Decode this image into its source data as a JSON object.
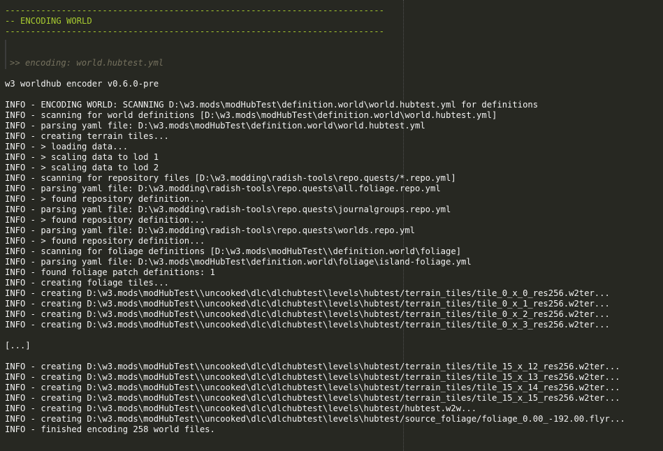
{
  "header": {
    "separator_top": "--------------------------------------------------------------------------",
    "title": "-- ENCODING WORLD",
    "separator_bottom": "--------------------------------------------------------------------------",
    "hint": ">> encoding: world.hubtest.yml"
  },
  "version_line": "w3 worldhub encoder v0.6.0-pre",
  "log_block_1": [
    "INFO - ENCODING WORLD: SCANNING D:\\w3.mods\\modHubTest\\definition.world\\world.hubtest.yml for definitions",
    "INFO - scanning for world definitions [D:\\w3.mods\\modHubTest\\definition.world\\world.hubtest.yml]",
    "INFO - parsing yaml file: D:\\w3.mods\\modHubTest\\definition.world\\world.hubtest.yml",
    "INFO - creating terrain tiles...",
    "INFO - > loading data...",
    "INFO - > scaling data to lod 1",
    "INFO - > scaling data to lod 2",
    "INFO - scanning for repository files [D:\\w3.modding\\radish-tools\\repo.quests/*.repo.yml]",
    "INFO - parsing yaml file: D:\\w3.modding\\radish-tools\\repo.quests\\all.foliage.repo.yml",
    "INFO - > found repository definition...",
    "INFO - parsing yaml file: D:\\w3.modding\\radish-tools\\repo.quests\\journalgroups.repo.yml",
    "INFO - > found repository definition...",
    "INFO - parsing yaml file: D:\\w3.modding\\radish-tools\\repo.quests\\worlds.repo.yml",
    "INFO - > found repository definition...",
    "INFO - scanning for foliage definitions [D:\\w3.mods\\modHubTest\\\\definition.world\\foliage]",
    "INFO - parsing yaml file: D:\\w3.mods\\modHubTest\\definition.world\\foliage\\island-foliage.yml",
    "INFO - found foliage patch definitions: 1",
    "INFO - creating foliage tiles...",
    "INFO - creating D:\\w3.mods\\modHubTest\\\\uncooked\\dlc\\dlchubtest\\levels\\hubtest/terrain_tiles/tile_0_x_0_res256.w2ter...",
    "INFO - creating D:\\w3.mods\\modHubTest\\\\uncooked\\dlc\\dlchubtest\\levels\\hubtest/terrain_tiles/tile_0_x_1_res256.w2ter...",
    "INFO - creating D:\\w3.mods\\modHubTest\\\\uncooked\\dlc\\dlchubtest\\levels\\hubtest/terrain_tiles/tile_0_x_2_res256.w2ter...",
    "INFO - creating D:\\w3.mods\\modHubTest\\\\uncooked\\dlc\\dlchubtest\\levels\\hubtest/terrain_tiles/tile_0_x_3_res256.w2ter..."
  ],
  "ellipsis": "[...]",
  "log_block_2": [
    "INFO - creating D:\\w3.mods\\modHubTest\\\\uncooked\\dlc\\dlchubtest\\levels\\hubtest/terrain_tiles/tile_15_x_12_res256.w2ter...",
    "INFO - creating D:\\w3.mods\\modHubTest\\\\uncooked\\dlc\\dlchubtest\\levels\\hubtest/terrain_tiles/tile_15_x_13_res256.w2ter...",
    "INFO - creating D:\\w3.mods\\modHubTest\\\\uncooked\\dlc\\dlchubtest\\levels\\hubtest/terrain_tiles/tile_15_x_14_res256.w2ter...",
    "INFO - creating D:\\w3.mods\\modHubTest\\\\uncooked\\dlc\\dlchubtest\\levels\\hubtest/terrain_tiles/tile_15_x_15_res256.w2ter...",
    "INFO - creating D:\\w3.mods\\modHubTest\\\\uncooked\\dlc\\dlchubtest\\levels\\hubtest/hubtest.w2w...",
    "INFO - creating D:\\w3.mods\\modHubTest\\\\uncooked\\dlc\\dlchubtest\\levels\\hubtest/source_foliage/foliage_0.00_-192.00.flyr...",
    "INFO - finished encoding 258 world files."
  ],
  "colors": {
    "background": "#272822",
    "accent_green": "#a6c930",
    "comment_gray": "#75715e",
    "text": "#f2f2f2"
  }
}
